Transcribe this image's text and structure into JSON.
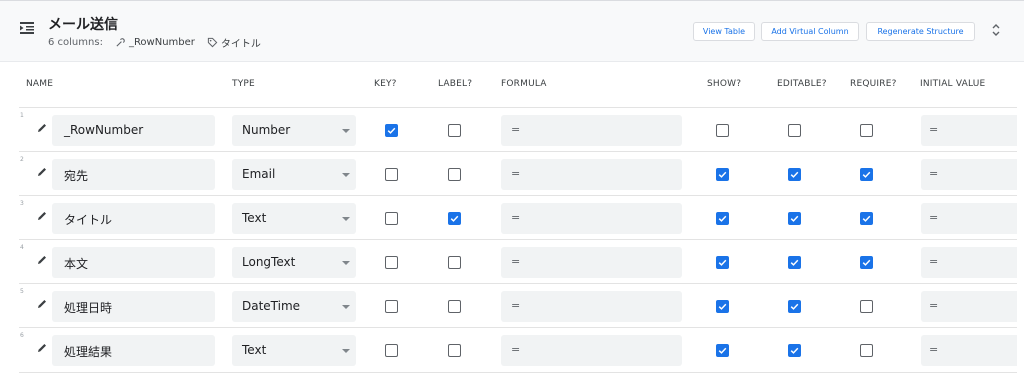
{
  "table": {
    "title": "メール送信",
    "columns_count": "6 columns:",
    "key_column": "_RowNumber",
    "label_column": "タイトル"
  },
  "toolbar": {
    "view_table": "View Table",
    "add_virtual_column": "Add Virtual Column",
    "regenerate_structure": "Regenerate Structure"
  },
  "headers": [
    "NAME",
    "TYPE",
    "KEY?",
    "LABEL?",
    "FORMULA",
    "SHOW?",
    "EDITABLE?",
    "REQUIRE?",
    "INITIAL VALUE"
  ],
  "rows": [
    {
      "num": "1",
      "name": "_RowNumber",
      "type": "Number",
      "key": true,
      "label": false,
      "formula": "=",
      "show": false,
      "editable": false,
      "require": false,
      "initial": "="
    },
    {
      "num": "2",
      "name": "宛先",
      "type": "Email",
      "key": false,
      "label": false,
      "formula": "=",
      "show": true,
      "editable": true,
      "require": true,
      "initial": "="
    },
    {
      "num": "3",
      "name": "タイトル",
      "type": "Text",
      "key": false,
      "label": true,
      "formula": "=",
      "show": true,
      "editable": true,
      "require": true,
      "initial": "="
    },
    {
      "num": "4",
      "name": "本文",
      "type": "LongText",
      "key": false,
      "label": false,
      "formula": "=",
      "show": true,
      "editable": true,
      "require": true,
      "initial": "="
    },
    {
      "num": "5",
      "name": "処理日時",
      "type": "DateTime",
      "key": false,
      "label": false,
      "formula": "=",
      "show": true,
      "editable": true,
      "require": false,
      "initial": "="
    },
    {
      "num": "6",
      "name": "処理結果",
      "type": "Text",
      "key": false,
      "label": false,
      "formula": "=",
      "show": true,
      "editable": true,
      "require": false,
      "initial": "="
    }
  ],
  "colors": {
    "accent": "#1a73e8",
    "field_bg": "#f1f3f4",
    "header_bg": "#f8f9fa"
  }
}
